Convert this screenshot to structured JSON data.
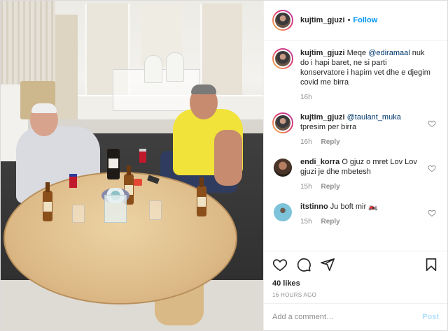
{
  "post": {
    "username": "kujtim_gjuzi",
    "separator": "•",
    "follow_label": "Follow"
  },
  "caption": {
    "username": "kujtim_gjuzi",
    "text_before": " Meqe ",
    "mention": "@ediramaal",
    "text_after": " nuk do i hapi baret, ne si parti konservatore i hapim vet dhe e djegim covid me birra",
    "time": "16h"
  },
  "comments": [
    {
      "username": "kujtim_gjuzi",
      "mention": "@taulant_muka",
      "text": "tpresim per birra",
      "time": "16h",
      "reply": "Reply"
    },
    {
      "username": "endi_korra",
      "text": "O gjuz o mret Lov Lov gjuzi je dhe mbetesh",
      "time": "15h",
      "reply": "Reply"
    },
    {
      "username": "itstinno",
      "text": "Ju boft mir 🏍️",
      "time": "15h",
      "reply": "Reply"
    }
  ],
  "actions": {
    "likes": "40 likes",
    "ago": "16 HOURS AGO"
  },
  "add_comment": {
    "placeholder": "Add a comment…",
    "post_label": "Post"
  },
  "icons": {
    "like": "heart-icon",
    "comment": "comment-icon",
    "share": "share-icon",
    "save": "bookmark-icon",
    "comment_like": "heart-icon"
  },
  "colors": {
    "link_blue": "#0095f6",
    "mention": "#00376b",
    "muted": "#8e8e8e",
    "post_disabled": "#b2dffc",
    "story_ring_start": "#f9c449",
    "story_ring_end": "#b73aa8"
  }
}
